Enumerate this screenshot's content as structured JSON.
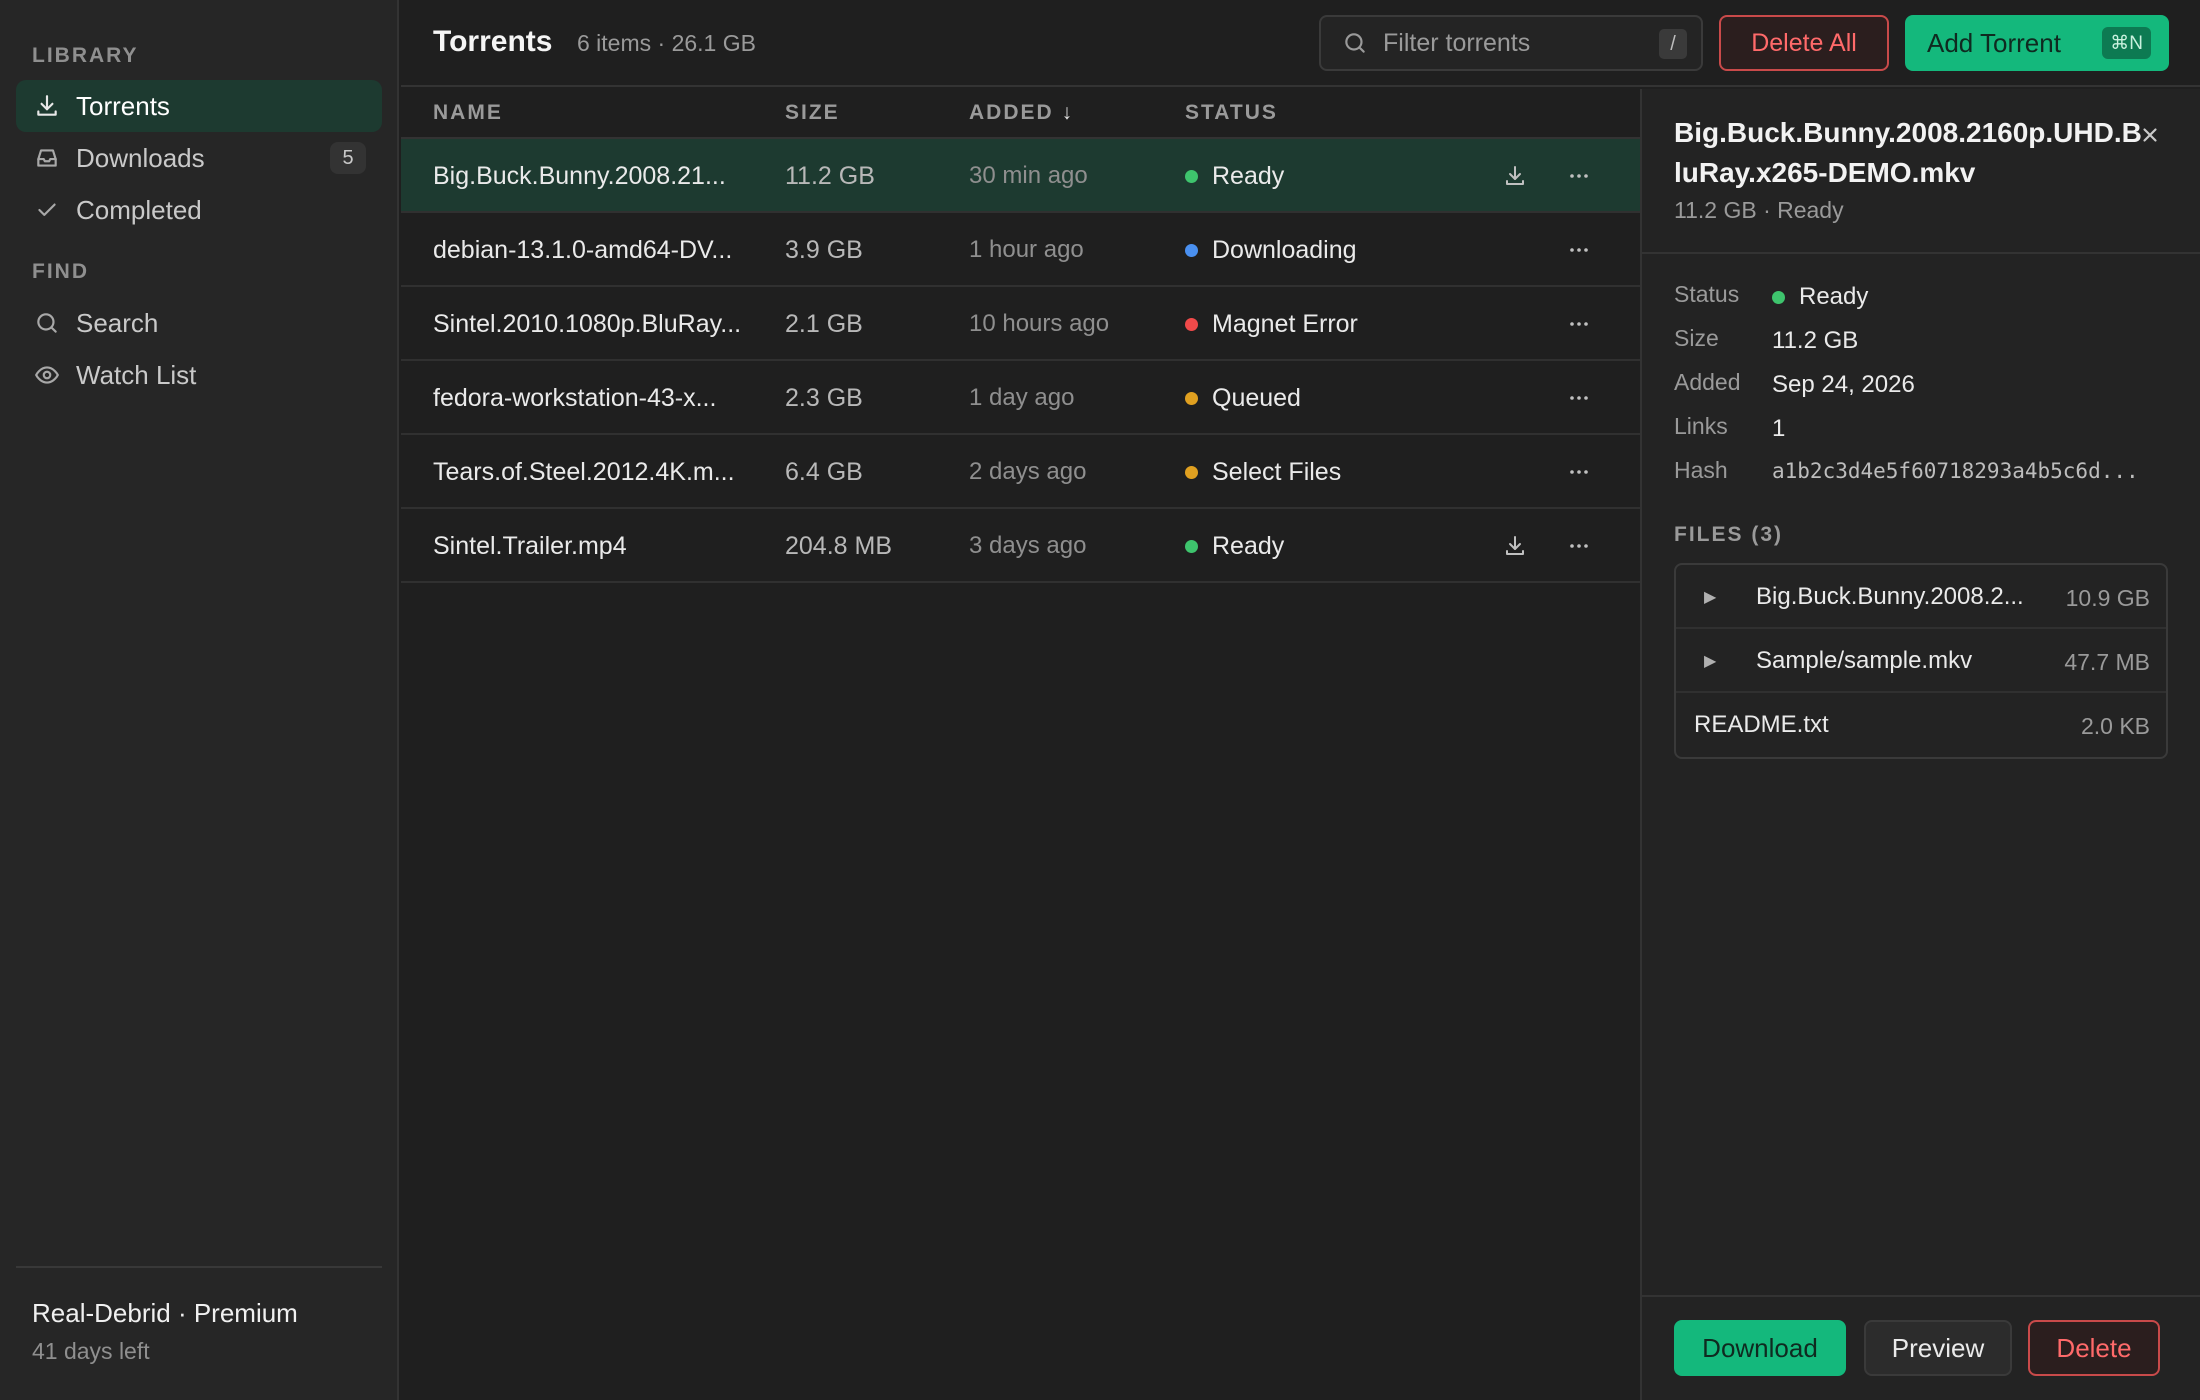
{
  "sidebar": {
    "library_label": "LIBRARY",
    "find_label": "FIND",
    "items": [
      {
        "label": "Torrents",
        "icon": "download-icon"
      },
      {
        "label": "Downloads",
        "icon": "inbox-icon",
        "badge": "5"
      },
      {
        "label": "Completed",
        "icon": "check-icon"
      },
      {
        "label": "Search",
        "icon": "search-icon"
      },
      {
        "label": "Watch List",
        "icon": "eye-icon"
      }
    ],
    "account": {
      "title": "Real-Debrid · Premium",
      "subtitle": "41 days left"
    }
  },
  "header": {
    "title": "Torrents",
    "meta": "6 items · 26.1 GB",
    "search_placeholder": "Filter torrents",
    "search_shortcut": "/",
    "delete_all_label": "Delete All",
    "add_label": "Add Torrent",
    "add_shortcut": "⌘N"
  },
  "table": {
    "columns": {
      "name": "NAME",
      "size": "SIZE",
      "added": "ADDED",
      "added_sort": "↓",
      "status": "STATUS"
    },
    "rows": [
      {
        "name": "Big.Buck.Bunny.2008.21...",
        "size": "11.2 GB",
        "added": "30 min ago",
        "status": "Ready",
        "status_color": "#3ec46d",
        "downloadable": true
      },
      {
        "name": "debian-13.1.0-amd64-DV...",
        "size": "3.9 GB",
        "added": "1 hour ago",
        "status": "Downloading",
        "status_color": "#4a90f0",
        "downloadable": false
      },
      {
        "name": "Sintel.2010.1080p.BluRay...",
        "size": "2.1 GB",
        "added": "10 hours ago",
        "status": "Magnet Error",
        "status_color": "#f04a4a",
        "downloadable": false
      },
      {
        "name": "fedora-workstation-43-x...",
        "size": "2.3 GB",
        "added": "1 day ago",
        "status": "Queued",
        "status_color": "#e0a020",
        "downloadable": false
      },
      {
        "name": "Tears.of.Steel.2012.4K.m...",
        "size": "6.4 GB",
        "added": "2 days ago",
        "status": "Select Files",
        "status_color": "#e0a020",
        "downloadable": false
      },
      {
        "name": "Sintel.Trailer.mp4",
        "size": "204.8 MB",
        "added": "3 days ago",
        "status": "Ready",
        "status_color": "#3ec46d",
        "downloadable": true
      }
    ]
  },
  "detail": {
    "title": "Big.Buck.Bunny.2008.2160p.UHD.BluRay.x265-DEMO.mkv",
    "subtitle": "11.2 GB · Ready",
    "fields": {
      "status_key": "Status",
      "status_val": "Ready",
      "status_color": "#3ec46d",
      "size_key": "Size",
      "size_val": "11.2 GB",
      "added_key": "Added",
      "added_val": "Sep 24, 2026",
      "links_key": "Links",
      "links_val": "1",
      "hash_key": "Hash",
      "hash_val": "a1b2c3d4e5f60718293a4b5c6d..."
    },
    "files_label": "FILES (3)",
    "files": [
      {
        "name": "Big.Buck.Bunny.2008.2...",
        "size": "10.9 GB",
        "expandable": true
      },
      {
        "name": "Sample/sample.mkv",
        "size": "47.7 MB",
        "expandable": true
      },
      {
        "name": "README.txt",
        "size": "2.0 KB",
        "expandable": false
      }
    ],
    "actions": {
      "download": "Download",
      "preview": "Preview",
      "delete": "Delete"
    }
  }
}
